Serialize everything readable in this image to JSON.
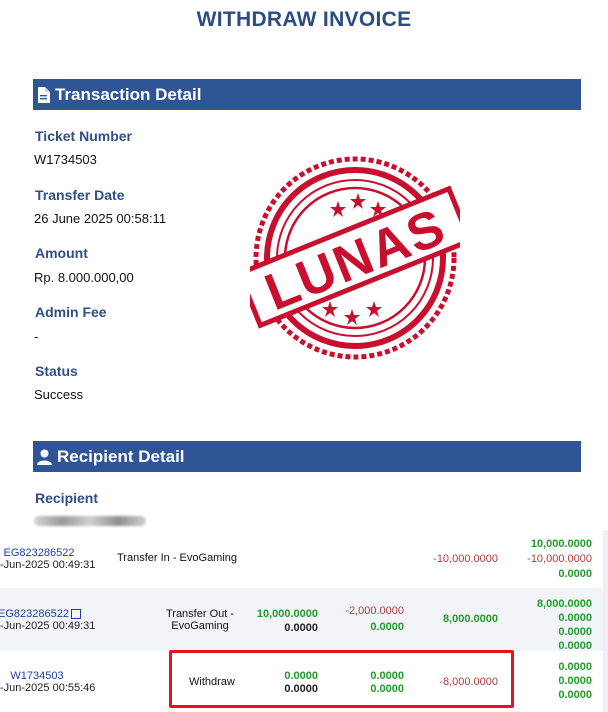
{
  "title": "WITHDRAW INVOICE",
  "transaction_section": {
    "title": "Transaction Detail",
    "icon": "document-icon",
    "fields": [
      {
        "label": "Ticket Number",
        "value": "W1734503"
      },
      {
        "label": "Transfer Date",
        "value": "26 June 2025 00:58:11"
      },
      {
        "label": "Amount",
        "value": "Rp. 8.000.000,00"
      },
      {
        "label": "Admin Fee",
        "value": "-"
      },
      {
        "label": "Status",
        "value": "Success"
      }
    ]
  },
  "stamp": {
    "text": "LUNAS",
    "color": "#c8102e"
  },
  "recipient_section": {
    "title": "Recipient Detail",
    "icon": "user-icon",
    "recipient_label": "Recipient"
  },
  "transactions": [
    {
      "ticket": "EG823286522",
      "date": "-Jun-2025 00:49:31",
      "type": "Transfer In - EvoGaming",
      "col3": "-10,000.0000",
      "bal": [
        "10,000.0000",
        "-10,000.0000",
        "0.0000"
      ]
    },
    {
      "ticket": "EG823286522",
      "date": "-Jun-2025 00:49:31",
      "type_line1": "Transfer Out -",
      "type_line2": "EvoGaming",
      "col1": [
        "10,000.0000",
        "0.0000"
      ],
      "col2": [
        "-2,000.0000",
        "0.0000"
      ],
      "col3": "8,000.0000",
      "bal": [
        "8,000.0000",
        "0.0000",
        "0.0000",
        "0.0000"
      ]
    },
    {
      "ticket": "W1734503",
      "date": "-Jun-2025 00:55:46",
      "type": "Withdraw",
      "col1": [
        "0.0000",
        "0.0000"
      ],
      "col2": [
        "0.0000",
        "0.0000"
      ],
      "col3": "-8,000.0000",
      "bal": [
        "0.0000",
        "0.0000",
        "0.0000",
        "0.0000"
      ]
    }
  ],
  "colors": {
    "accent": "#2f5597",
    "highlight": "#e8121c",
    "positive": "#1f9e2a",
    "negative": "#b23b3b"
  }
}
